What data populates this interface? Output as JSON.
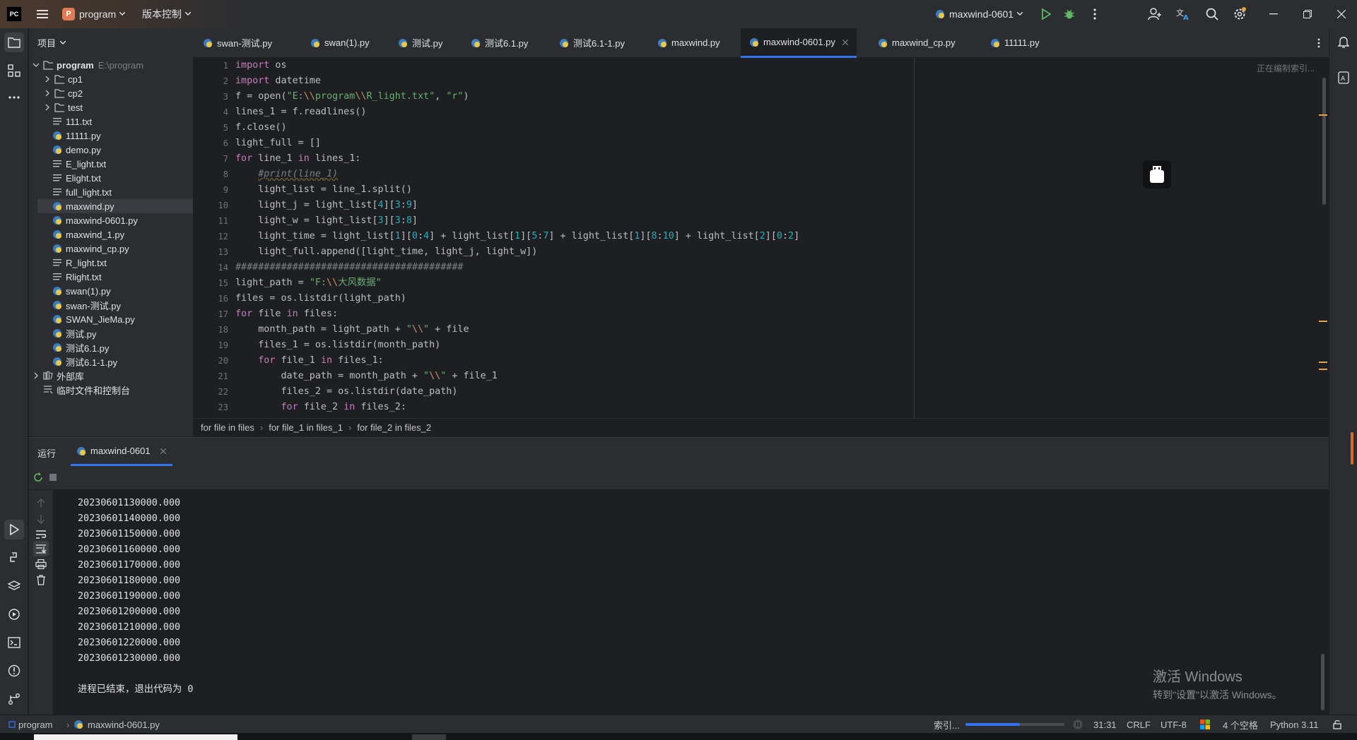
{
  "titlebar": {
    "app_logo": "PC",
    "project_badge": "P",
    "project_name": "program",
    "vcs_label": "版本控制",
    "run_config": "maxwind-0601"
  },
  "project_panel": {
    "header": "项目",
    "root_name": "program",
    "root_path": "E:\\program",
    "items": [
      {
        "name": "cp1",
        "type": "folder"
      },
      {
        "name": "cp2",
        "type": "folder"
      },
      {
        "name": "test",
        "type": "folder"
      },
      {
        "name": "111.txt",
        "type": "txt"
      },
      {
        "name": "11111.py",
        "type": "py"
      },
      {
        "name": "demo.py",
        "type": "py"
      },
      {
        "name": "E_light.txt",
        "type": "txt"
      },
      {
        "name": "Elight.txt",
        "type": "txt"
      },
      {
        "name": "full_light.txt",
        "type": "txt"
      },
      {
        "name": "maxwind.py",
        "type": "py"
      },
      {
        "name": "maxwind-0601.py",
        "type": "py"
      },
      {
        "name": "maxwind_1.py",
        "type": "py"
      },
      {
        "name": "maxwind_cp.py",
        "type": "py"
      },
      {
        "name": "R_light.txt",
        "type": "txt"
      },
      {
        "name": "Rlight.txt",
        "type": "txt"
      },
      {
        "name": "swan(1).py",
        "type": "py"
      },
      {
        "name": "swan-测试.py",
        "type": "py"
      },
      {
        "name": "SWAN_JieMa.py",
        "type": "py"
      },
      {
        "name": "测试.py",
        "type": "py"
      },
      {
        "name": "测试6.1.py",
        "type": "py"
      },
      {
        "name": "测试6.1-1.py",
        "type": "py"
      }
    ],
    "external_libs": "外部库",
    "scratches": "临时文件和控制台"
  },
  "tabs": [
    "swan-测试.py",
    "swan(1).py",
    "测试.py",
    "测试6.1.py",
    "测试6.1-1.py",
    "maxwind.py",
    "maxwind-0601.py",
    "maxwind_cp.py",
    "11111.py"
  ],
  "editor": {
    "indexing_note": "正在编制索引...",
    "line_numbers": [
      "1",
      "2",
      "3",
      "4",
      "5",
      "6",
      "7",
      "8",
      "9",
      "10",
      "11",
      "12",
      "13",
      "14",
      "15",
      "16",
      "17",
      "18",
      "19",
      "20",
      "21",
      "22",
      "23"
    ],
    "lines": [
      "import os",
      "import datetime",
      "f = open(\"E:\\\\program\\\\R_light.txt\", \"r\")",
      "lines_1 = f.readlines()",
      "f.close()",
      "light_full = []",
      "for line_1 in lines_1:",
      "    #print(line_1)",
      "    light_list = line_1.split()",
      "    light_j = light_list[4][3:9]",
      "    light_w = light_list[3][3:8]",
      "    light_time = light_list[1][0:4] + light_list[1][5:7] + light_list[1][8:10] + light_list[2][0:2]",
      "    light_full.append([light_time, light_j, light_w])",
      "########################################",
      "light_path = \"F:\\\\大风数据\"",
      "files = os.listdir(light_path)",
      "for file in files:",
      "    month_path = light_path + \"\\\\\" + file",
      "    files_1 = os.listdir(month_path)",
      "    for file_1 in files_1:",
      "        date_path = month_path + \"\\\\\" + file_1",
      "        files_2 = os.listdir(date_path)",
      "        for file_2 in files_2:"
    ]
  },
  "breadcrumb": [
    "for file in files",
    "for file_1 in files_1",
    "for file_2 in files_2"
  ],
  "run_panel": {
    "title": "运行",
    "tab": "maxwind-0601",
    "output": [
      "20230601130000.000",
      "20230601140000.000",
      "20230601150000.000",
      "20230601160000.000",
      "20230601170000.000",
      "20230601180000.000",
      "20230601190000.000",
      "20230601200000.000",
      "20230601210000.000",
      "20230601220000.000",
      "20230601230000.000"
    ],
    "exit_message": "进程已结束，退出代码为 0",
    "watermark_title": "激活 Windows",
    "watermark_sub": "转到\"设置\"以激活 Windows。"
  },
  "statusbar": {
    "project": "program",
    "file": "maxwind-0601.py",
    "indexing": "索引...",
    "indexing_progress": 0.55,
    "position": "31:31",
    "line_ending": "CRLF",
    "encoding": "UTF-8",
    "indent": "4 个空格",
    "interpreter": "Python 3.11"
  },
  "colors": {
    "accent": "#3574f0",
    "keyword": "#cf8e6d",
    "string": "#6aab73",
    "number": "#2aacb8",
    "python_icon": "#3b7bbf"
  }
}
